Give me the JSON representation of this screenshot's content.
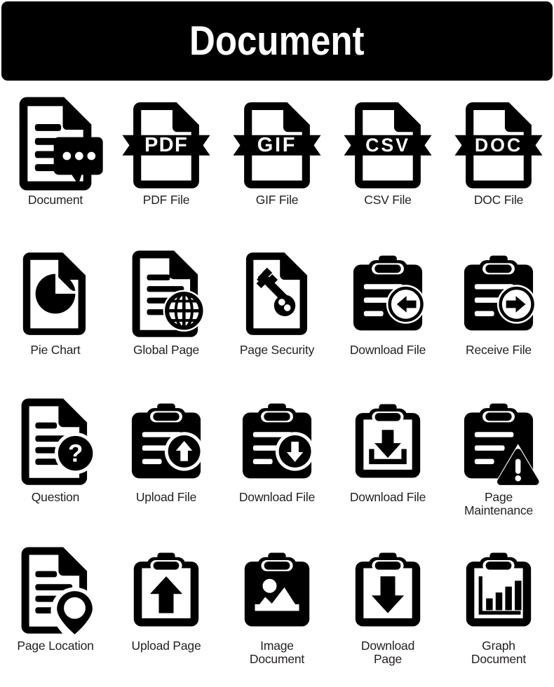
{
  "header": {
    "title": "Document",
    "background_color": "#000000",
    "text_color": "#ffffff"
  },
  "theme": {
    "icon_color": "#000000",
    "label_color": "#231f20",
    "page_background": "#ffffff"
  },
  "grid": {
    "columns": 5,
    "rows": 4
  },
  "icons": [
    {
      "label": "Document",
      "icon": "document-chat-icon"
    },
    {
      "label": "PDF File",
      "icon": "file-ribbon-icon",
      "ribbon_text": "PDF"
    },
    {
      "label": "GIF File",
      "icon": "file-ribbon-icon",
      "ribbon_text": "GIF"
    },
    {
      "label": "CSV File",
      "icon": "file-ribbon-icon",
      "ribbon_text": "CSV"
    },
    {
      "label": "DOC File",
      "icon": "file-ribbon-icon",
      "ribbon_text": "DOC"
    },
    {
      "label": "Pie Chart",
      "icon": "page-pie-chart-icon"
    },
    {
      "label": "Global Page",
      "icon": "page-globe-icon"
    },
    {
      "label": "Page Security",
      "icon": "page-key-icon"
    },
    {
      "label": "Download File",
      "icon": "clipboard-arrow-left-icon"
    },
    {
      "label": "Receive File",
      "icon": "clipboard-arrow-right-icon"
    },
    {
      "label": "Question",
      "icon": "page-question-icon"
    },
    {
      "label": "Upload File",
      "icon": "clipboard-arrow-up-circle-icon"
    },
    {
      "label": "Download File",
      "icon": "clipboard-arrow-down-circle-icon"
    },
    {
      "label": "Download File",
      "icon": "clipboard-download-tray-icon"
    },
    {
      "label": "Page\nMaintenance",
      "icon": "clipboard-warning-icon"
    },
    {
      "label": "Page Location",
      "icon": "page-map-pin-icon"
    },
    {
      "label": "Upload Page",
      "icon": "clipboard-arrow-up-icon"
    },
    {
      "label": "Image\nDocument",
      "icon": "clipboard-image-icon"
    },
    {
      "label": "Download\nPage",
      "icon": "clipboard-arrow-down-icon"
    },
    {
      "label": "Graph\nDocument",
      "icon": "clipboard-bar-chart-icon"
    }
  ]
}
